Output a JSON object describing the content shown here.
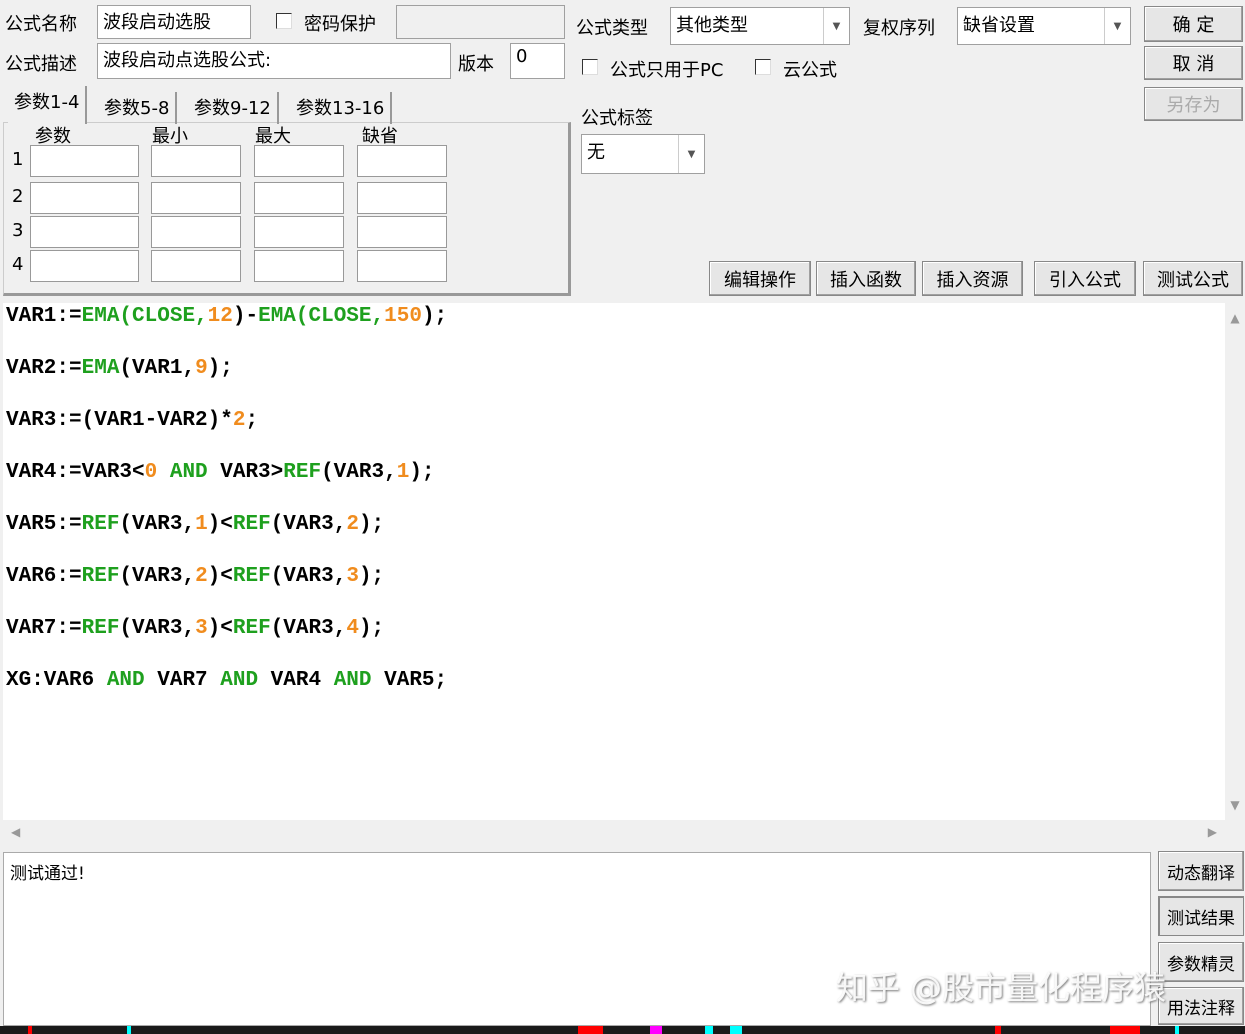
{
  "header": {
    "name_label": "公式名称",
    "name_value": "波段启动选股",
    "password_label": "密码保护",
    "password_value": "",
    "desc_label": "公式描述",
    "desc_value": "波段启动点选股公式:",
    "version_label": "版本",
    "version_value": "0",
    "type_label": "公式类型",
    "type_value": "其他类型",
    "rights_label": "复权序列",
    "rights_value": "缺省设置",
    "pc_only_label": "公式只用于PC",
    "cloud_label": "云公式",
    "tag_label": "公式标签",
    "tag_value": "无"
  },
  "buttons": {
    "ok": "确 定",
    "cancel": "取 消",
    "save_as": "另存为",
    "edit": "编辑操作",
    "insert_func": "插入函数",
    "insert_res": "插入资源",
    "import": "引入公式",
    "test": "测试公式",
    "translate": "动态翻译",
    "test_result": "测试结果",
    "param_wizard": "参数精灵",
    "usage": "用法注释"
  },
  "params": {
    "tabs": [
      "参数1-4",
      "参数5-8",
      "参数9-12",
      "参数13-16"
    ],
    "columns": [
      "参数",
      "最小",
      "最大",
      "缺省"
    ],
    "rows": [
      "1",
      "2",
      "3",
      "4"
    ]
  },
  "code": [
    [
      [
        "VAR1:=",
        "v"
      ],
      [
        "EMA(CLOSE,",
        "f"
      ],
      [
        "12",
        "n"
      ],
      [
        ")-",
        "v"
      ],
      [
        "EMA(CLOSE,",
        "f"
      ],
      [
        "150",
        "n"
      ],
      [
        ");",
        "v"
      ]
    ],
    [
      [
        "VAR2:=",
        "v"
      ],
      [
        "EMA",
        "f"
      ],
      [
        "(VAR1,",
        "v"
      ],
      [
        "9",
        "n"
      ],
      [
        ");",
        "v"
      ]
    ],
    [
      [
        "VAR3:=(VAR1-VAR2)*",
        "v"
      ],
      [
        "2",
        "n"
      ],
      [
        ";",
        "v"
      ]
    ],
    [
      [
        "VAR4:=VAR3<",
        "v"
      ],
      [
        "0",
        "n"
      ],
      [
        " AND ",
        "k"
      ],
      [
        "VAR3>",
        "v"
      ],
      [
        "REF",
        "f"
      ],
      [
        "(VAR3,",
        "v"
      ],
      [
        "1",
        "n"
      ],
      [
        ");",
        "v"
      ]
    ],
    [
      [
        "VAR5:=",
        "v"
      ],
      [
        "REF",
        "f"
      ],
      [
        "(VAR3,",
        "v"
      ],
      [
        "1",
        "n"
      ],
      [
        ")<",
        "v"
      ],
      [
        "REF",
        "f"
      ],
      [
        "(VAR3,",
        "v"
      ],
      [
        "2",
        "n"
      ],
      [
        ");",
        "v"
      ]
    ],
    [
      [
        "VAR6:=",
        "v"
      ],
      [
        "REF",
        "f"
      ],
      [
        "(VAR3,",
        "v"
      ],
      [
        "2",
        "n"
      ],
      [
        ")<",
        "v"
      ],
      [
        "REF",
        "f"
      ],
      [
        "(VAR3,",
        "v"
      ],
      [
        "3",
        "n"
      ],
      [
        ");",
        "v"
      ]
    ],
    [
      [
        "VAR7:=",
        "v"
      ],
      [
        "REF",
        "f"
      ],
      [
        "(VAR3,",
        "v"
      ],
      [
        "3",
        "n"
      ],
      [
        ")<",
        "v"
      ],
      [
        "REF",
        "f"
      ],
      [
        "(VAR3,",
        "v"
      ],
      [
        "4",
        "n"
      ],
      [
        ");",
        "v"
      ]
    ],
    [
      [
        "XG:VAR6",
        "v"
      ],
      [
        " AND ",
        "k"
      ],
      [
        "VAR7",
        "v"
      ],
      [
        " AND ",
        "k"
      ],
      [
        "VAR4",
        "v"
      ],
      [
        " AND ",
        "k"
      ],
      [
        "VAR5;",
        "v"
      ]
    ]
  ],
  "output": {
    "text": "测试通过!"
  },
  "watermark": "知乎 @股市量化程序猿"
}
